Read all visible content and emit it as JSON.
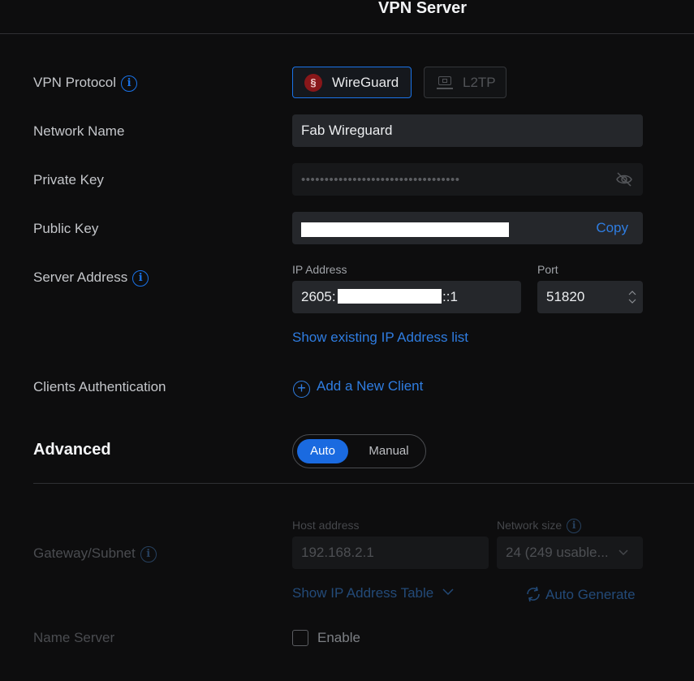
{
  "header": {
    "title": "VPN Server"
  },
  "vpn_protocol": {
    "label": "VPN Protocol",
    "options": [
      {
        "label": "WireGuard",
        "selected": true,
        "icon": "wireguard-logo"
      },
      {
        "label": "L2TP",
        "selected": false,
        "icon": "l2tp-server-icon"
      }
    ]
  },
  "network_name": {
    "label": "Network Name",
    "value": "Fab Wireguard"
  },
  "private_key": {
    "label": "Private Key",
    "masked_value": "••••••••••••••••••••••••••••••••••",
    "icon": "eye-hidden-icon"
  },
  "public_key": {
    "label": "Public Key",
    "copy_label": "Copy"
  },
  "server_address": {
    "label": "Server Address",
    "ip_label": "IP Address",
    "ip_prefix": "2605:",
    "ip_suffix": "::1",
    "port_label": "Port",
    "port_value": "51820",
    "show_list_link": "Show existing IP Address list"
  },
  "clients_auth": {
    "label": "Clients Authentication",
    "add_client": "Add a New Client"
  },
  "advanced": {
    "title": "Advanced",
    "mode_options": [
      "Auto",
      "Manual"
    ],
    "selected_mode": "Auto"
  },
  "gateway": {
    "label": "Gateway/Subnet",
    "host_label": "Host address",
    "host_value": "192.168.2.1",
    "netsize_label": "Network size",
    "netsize_value": "24 (249 usable...",
    "show_table": "Show IP Address Table",
    "auto_generate": "Auto Generate"
  },
  "name_server": {
    "label": "Name Server",
    "enable_label": "Enable",
    "checked": false
  },
  "colors": {
    "accent": "#1a73e8",
    "background": "#0d0d0e",
    "field": "#25272b",
    "wireguard": "#88171a"
  }
}
